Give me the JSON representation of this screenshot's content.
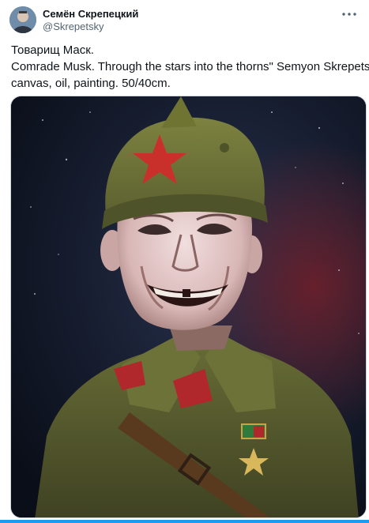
{
  "author": {
    "display_name": "Семён Скрепецкий",
    "handle": "@Skrepetsky",
    "avatar_icon": "avatar-portrait"
  },
  "tweet": {
    "lines": [
      "Товарищ Маск.",
      "Comrade Musk. Through the stars into the thorns\" Semyon Skrepetsky,",
      "canvas, oil, painting. 50/40cm."
    ]
  },
  "media": {
    "type": "painting",
    "colors": {
      "background": "#141b2d",
      "cap": "#6f7433",
      "uniform": "#5b6030",
      "star": "#c9302c",
      "skin": "#e6cfcf"
    }
  },
  "icons": {
    "more": "more-options-icon"
  },
  "accent_color": "#1d9bf0"
}
